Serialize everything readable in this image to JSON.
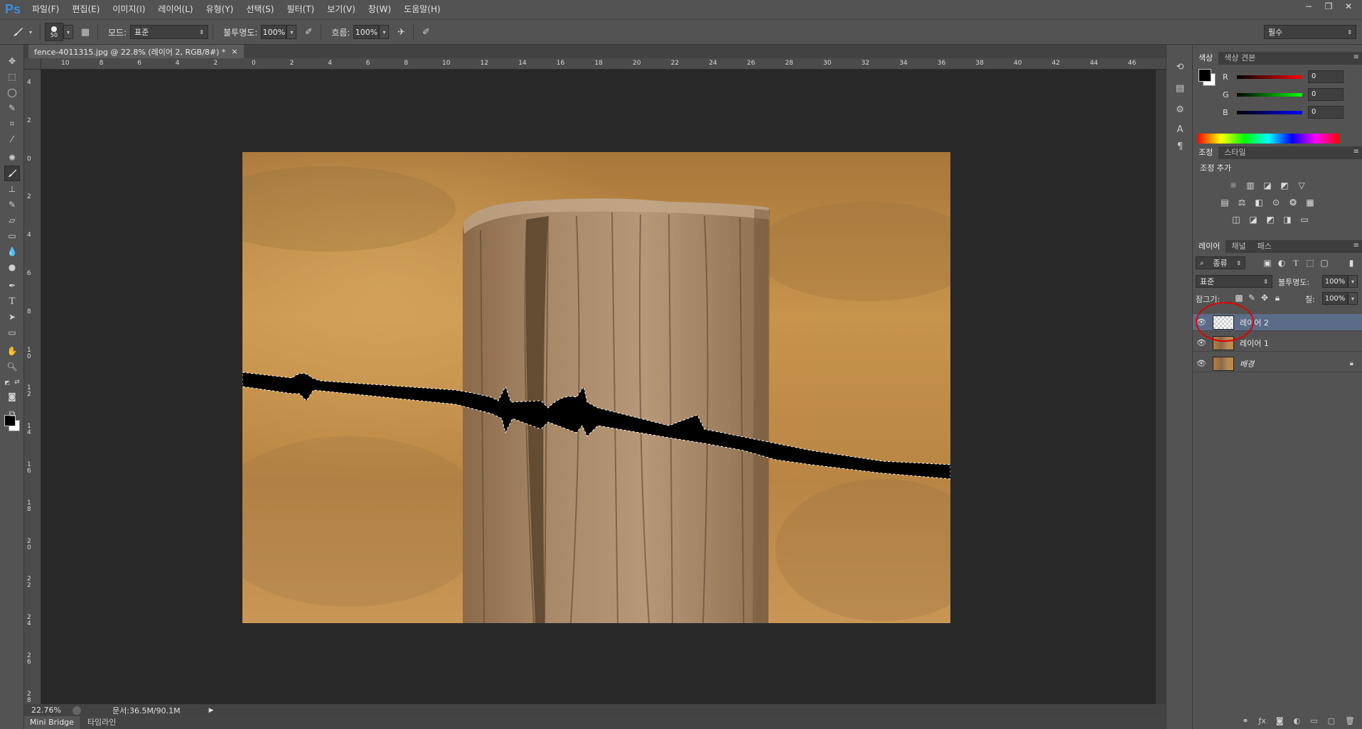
{
  "app": {
    "logo": "Ps"
  },
  "menu": [
    "파일(F)",
    "편집(E)",
    "이미지(I)",
    "레이어(L)",
    "유형(Y)",
    "선택(S)",
    "필터(T)",
    "보기(V)",
    "창(W)",
    "도움말(H)"
  ],
  "window_controls": {
    "minimize": "−",
    "restore": "❐",
    "close": "✕"
  },
  "options": {
    "brush_size": "50",
    "mode_label": "모드:",
    "mode_value": "표준",
    "opacity_label": "불투명도:",
    "opacity_value": "100%",
    "flow_label": "흐름:",
    "flow_value": "100%",
    "workspace": "필수"
  },
  "document": {
    "tab_title": "fence-4011315.jpg @ 22.8% (레이어 2, RGB/8#) *",
    "close": "×",
    "zoom": "22.76%",
    "doc_size": "문서:36.5M/90.1M"
  },
  "ruler_h": [
    "10",
    "8",
    "6",
    "4",
    "2",
    "0",
    "2",
    "4",
    "6",
    "8",
    "10",
    "12",
    "14",
    "16",
    "18",
    "20",
    "22",
    "24",
    "26",
    "28",
    "30",
    "32",
    "34",
    "36",
    "38",
    "40",
    "42",
    "44",
    "46"
  ],
  "ruler_v": [
    "4",
    "2",
    "0",
    "2",
    "4",
    "6",
    "8",
    "10",
    "12",
    "14",
    "16",
    "18",
    "20",
    "22",
    "24",
    "26",
    "28"
  ],
  "bottom_tabs": [
    "Mini Bridge",
    "타임라인"
  ],
  "color_panel": {
    "tabs": [
      "색상",
      "색상 견본"
    ],
    "r_label": "R",
    "g_label": "G",
    "b_label": "B",
    "r": "0",
    "g": "0",
    "b": "0",
    "fg_color": "#000000",
    "bg_color": "#ffffff"
  },
  "adjust_panel": {
    "tabs": [
      "조정",
      "스타일"
    ],
    "title": "조정 추가"
  },
  "layers_panel": {
    "tabs": [
      "레이어",
      "채널",
      "패스"
    ],
    "filter_label": "종류",
    "blend_mode": "표준",
    "opacity_label": "불투명도:",
    "opacity_value": "100%",
    "lock_label": "잠그기:",
    "fill_label": "칠:",
    "fill_value": "100%",
    "layers": [
      {
        "name": "레이어 2",
        "selected": true
      },
      {
        "name": "레이어 1",
        "selected": false
      },
      {
        "name": "배경",
        "selected": false,
        "locked": true
      }
    ]
  },
  "colors": {
    "accent": "#3d8fd8",
    "selection_highlight": "#5c6c88",
    "annotation_circle": "#e00000"
  }
}
